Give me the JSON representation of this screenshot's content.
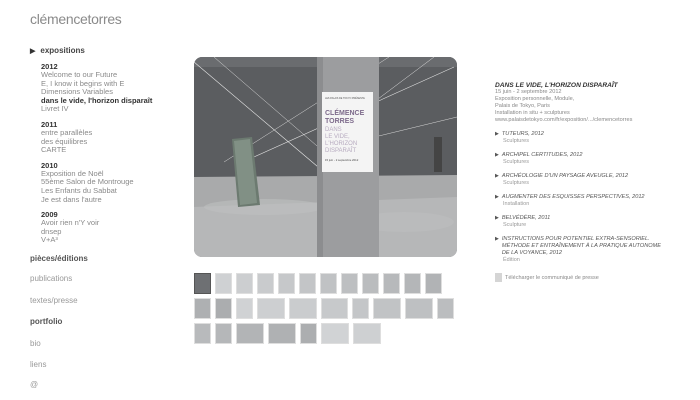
{
  "site": {
    "title": "clémencetorres"
  },
  "nav": {
    "exhibitions_label": "expositions",
    "groups": [
      {
        "year": "2012",
        "items": [
          {
            "label": "Welcome to our Future",
            "active": false
          },
          {
            "label": "E, I know it begins with E",
            "active": false
          },
          {
            "label": "Dimensions Variables",
            "active": false
          },
          {
            "label": "dans le vide, l'horizon disparaît",
            "active": true
          },
          {
            "label": "Livret IV",
            "active": false
          }
        ]
      },
      {
        "year": "2011",
        "items": [
          {
            "label": "entre parallèles",
            "active": false
          },
          {
            "label": "des équilibres",
            "active": false
          },
          {
            "label": "CARTE",
            "active": false
          }
        ]
      },
      {
        "year": "2010",
        "items": [
          {
            "label": "Exposition de Noël",
            "active": false
          },
          {
            "label": "55ème Salon de Montrouge",
            "active": false
          },
          {
            "label": "Les Enfants du Sabbat",
            "active": false
          },
          {
            "label": "Je est dans l'autre",
            "active": false
          }
        ]
      },
      {
        "year": "2009",
        "items": [
          {
            "label": "Avoir rien n'Y voir",
            "active": false
          },
          {
            "label": "dnsep",
            "active": false
          },
          {
            "label": "V+A³",
            "active": false
          }
        ]
      }
    ],
    "menu": [
      {
        "label": "pièces/éditions",
        "bold": true
      },
      {
        "label": "publications",
        "bold": false
      },
      {
        "label": "textes/presse",
        "bold": false
      },
      {
        "label": "portfolio",
        "bold": true
      },
      {
        "label": "bio",
        "bold": false
      },
      {
        "label": "liens",
        "bold": false
      },
      {
        "label": "@",
        "bold": false
      }
    ]
  },
  "poster": {
    "header": "LES PALAIS DE TOKYO PRÉSENTE",
    "name1": "CLÉMENCE",
    "name2": "TORRES",
    "line1": "DANS",
    "line2": "LE VIDE,",
    "line3": "L'HORIZON",
    "line4": "DISPARAÎT",
    "dates": "15 juin - 2 septembre 2012"
  },
  "info": {
    "title": "DANS LE VIDE, L'HORIZON DISPARAÎT",
    "lines": [
      "15 juin - 2 septembre 2012",
      "Exposition personnelle, Module,",
      "Palais de Tokyo, Paris",
      "Installation in situ + sculptures",
      "www.palaisdetokyo.com/fr/exposition/.../clemencetorres"
    ],
    "related": [
      {
        "title": "TUTEURS, 2012",
        "sub": "Sculptures"
      },
      {
        "title": "ARCHIPEL CERTITUDES, 2012",
        "sub": "Sculptures"
      },
      {
        "title": "ARCHÉOLOGIE D'UN PAYSAGE AVEUGLE, 2012",
        "sub": "Sculptures"
      },
      {
        "title": "AUGMENTER DES ESQUISSES PERSPECTIVES, 2012",
        "sub": "Installation"
      },
      {
        "title": "BELVÉDÈRE, 2011",
        "sub": "Sculpture"
      },
      {
        "title": "INSTRUCTIONS POUR POTENTIEL EXTRA-SENSORIEL. MÉTHODE ET ENTRAÎNEMENT À LA PRATIQUE AUTONOME DE LA VOYANCE, 2012",
        "sub": "Édition"
      }
    ],
    "press_label": "Télécharger le communiqué de presse"
  },
  "thumbnails": {
    "count": 31,
    "selected": 0
  }
}
